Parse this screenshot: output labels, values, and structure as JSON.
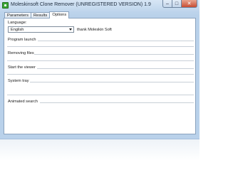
{
  "window": {
    "title": "Moleskinsoft Clone Remover (UNREGISTERED VERSION) 1.9",
    "app_icon": "green-app-icon",
    "controls": {
      "minimize": "–",
      "maximize": "□",
      "close": "✕"
    }
  },
  "tabs": [
    {
      "label": "Parameters",
      "active": false
    },
    {
      "label": "Results",
      "active": false
    },
    {
      "label": "Options",
      "active": true
    }
  ],
  "options": {
    "language_label": "Language:",
    "language_value": "English",
    "thanks_text": "thank Moleskin Soft",
    "sections": {
      "program_launch": "Program launch",
      "removing_files": "Removing files",
      "start_viewer": "Start the viewer",
      "system_tray": "System tray",
      "animated_search": "Animated search"
    }
  },
  "colors": {
    "frame": "#b9d1ea",
    "close_button": "#c74d32",
    "separator": "#c8cfd7"
  }
}
